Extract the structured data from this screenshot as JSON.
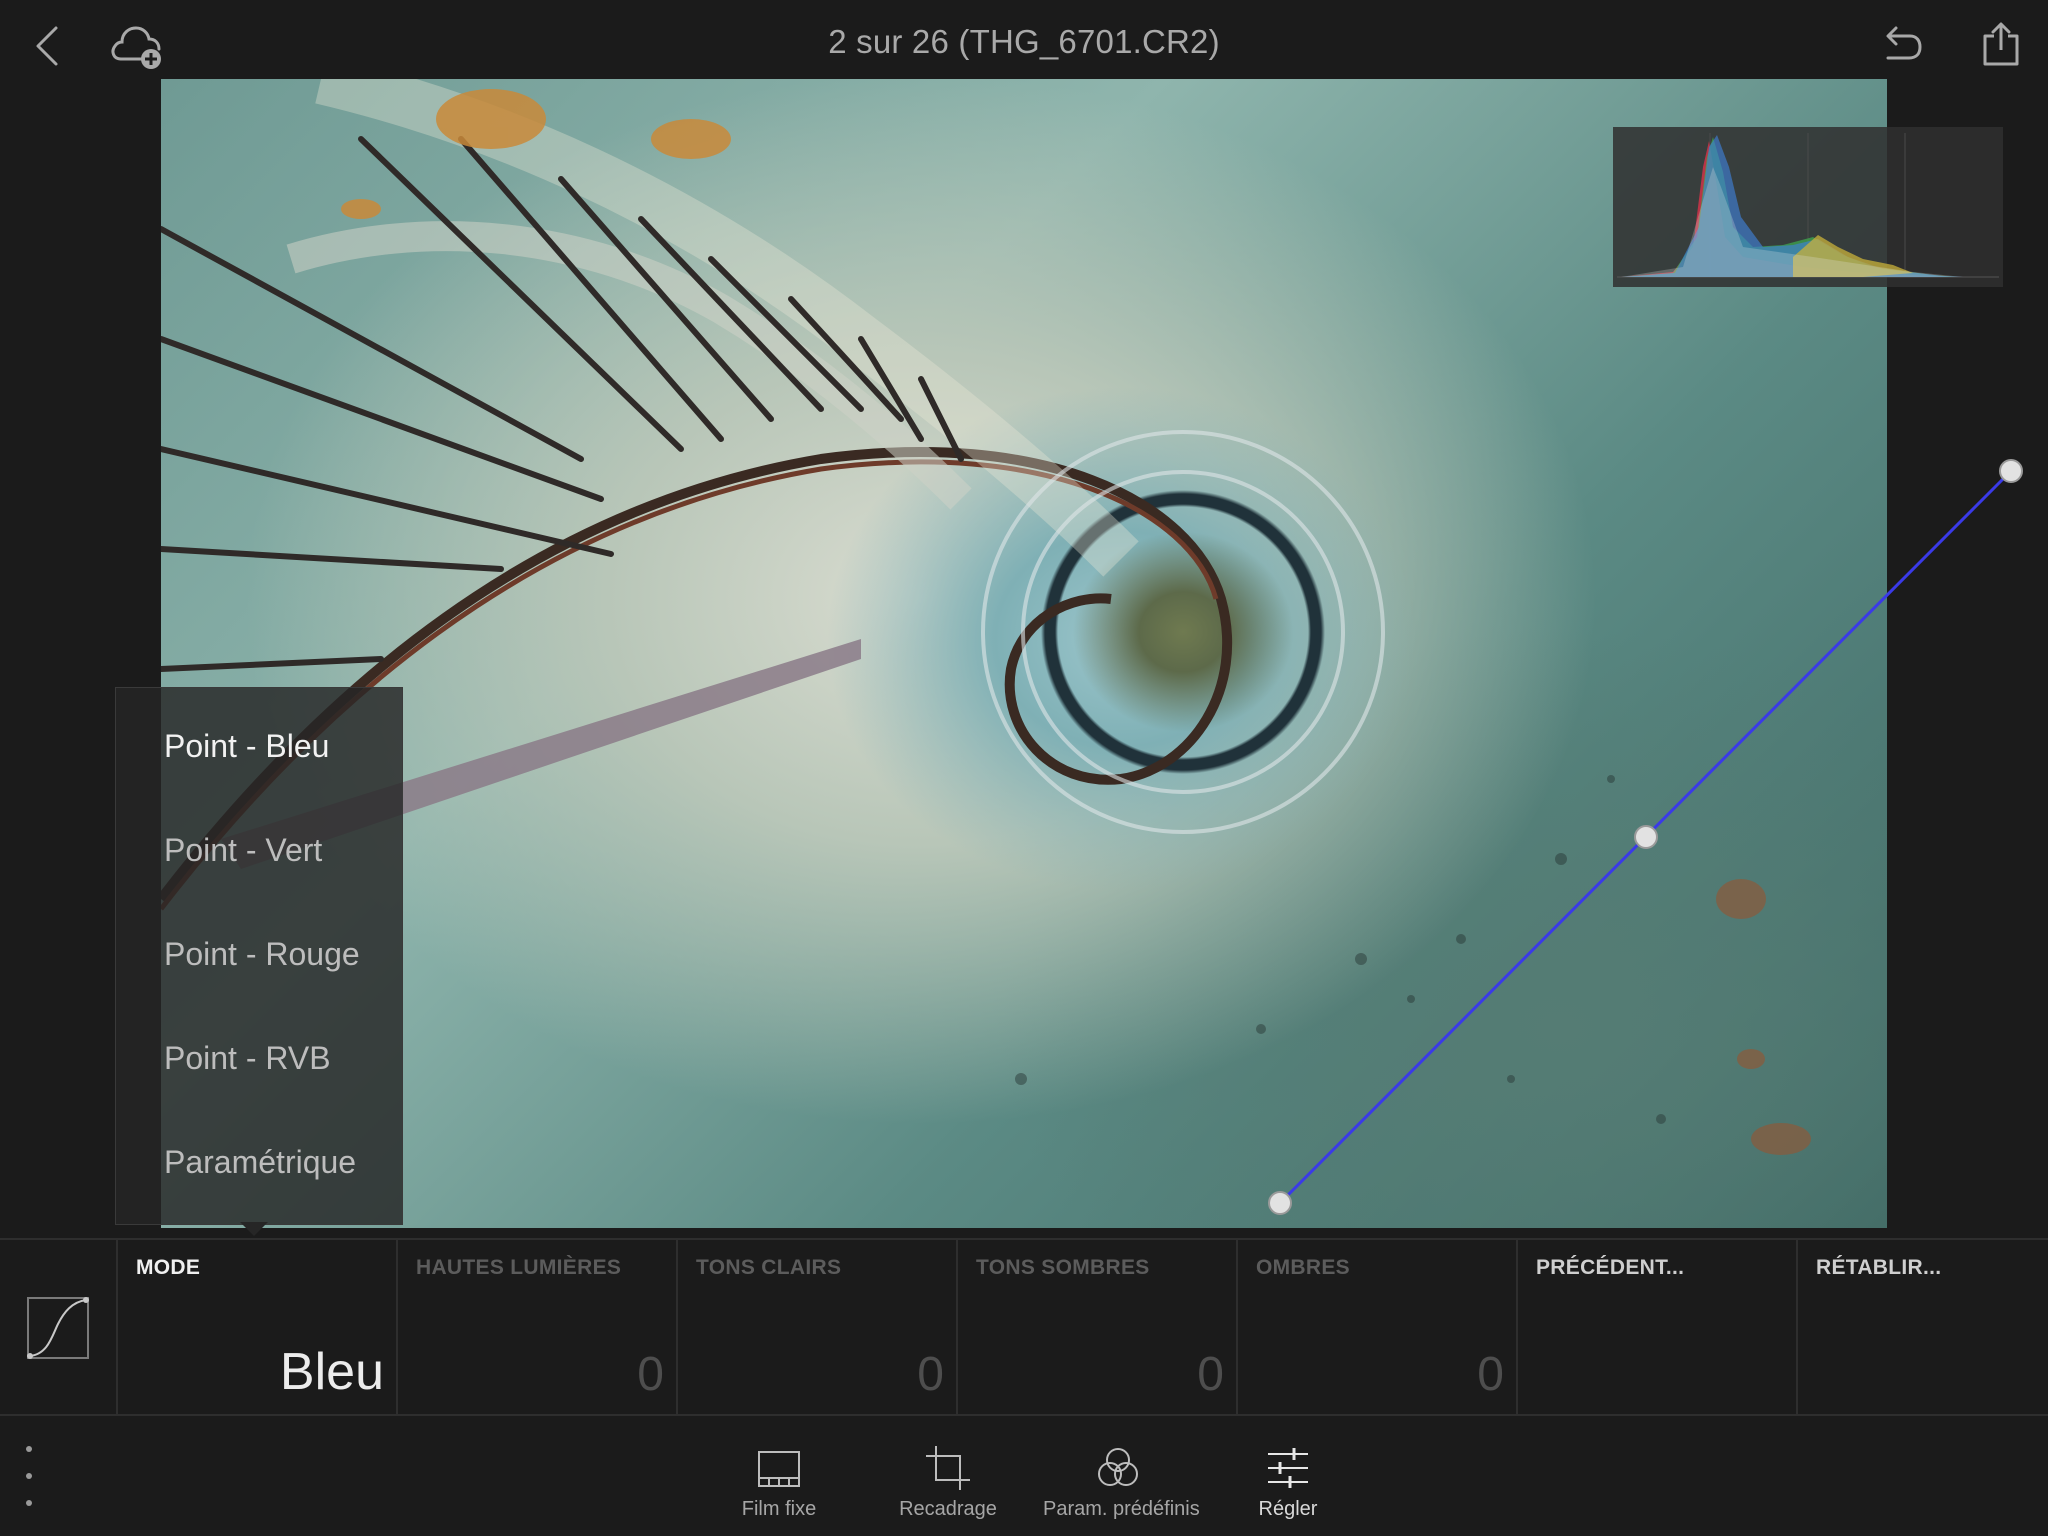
{
  "header": {
    "title": "2 sur 26 (THG_6701.CR2)",
    "icons": {
      "back": "chevron-left-icon",
      "cloud": "cloud-add-icon",
      "undo": "undo-icon",
      "share": "share-icon"
    }
  },
  "mode_menu": {
    "items": [
      {
        "label": "Point - Bleu",
        "active": true
      },
      {
        "label": "Point - Vert",
        "active": false
      },
      {
        "label": "Point - Rouge",
        "active": false
      },
      {
        "label": "Point - RVB",
        "active": false
      },
      {
        "label": "Paramétrique",
        "active": false
      }
    ]
  },
  "tone_curve": {
    "channel_color": "#3a3ae8",
    "points": [
      {
        "input": 0,
        "output": 0
      },
      {
        "input": 0.5,
        "output": 0.5
      },
      {
        "input": 1,
        "output": 1
      }
    ]
  },
  "panel": {
    "tool_icon": "tone-curve-icon",
    "cells": [
      {
        "label": "MODE",
        "value": "Bleu",
        "style": "active"
      },
      {
        "label": "HAUTES LUMIÈRES",
        "value": "0",
        "style": "dim"
      },
      {
        "label": "TONS CLAIRS",
        "value": "0",
        "style": "dim"
      },
      {
        "label": "TONS SOMBRES",
        "value": "0",
        "style": "dim"
      },
      {
        "label": "OMBRES",
        "value": "0",
        "style": "dim"
      },
      {
        "label": "PRÉCÉDENT...",
        "value": "",
        "style": "bright"
      },
      {
        "label": "RÉTABLIR...",
        "value": "",
        "style": "bright"
      }
    ]
  },
  "toolbar": {
    "more_icon": "more-vertical-icon",
    "tools": [
      {
        "label": "Film fixe",
        "icon": "filmstrip-icon"
      },
      {
        "label": "Recadrage",
        "icon": "crop-icon"
      },
      {
        "label": "Param. prédéfinis",
        "icon": "presets-icon"
      },
      {
        "label": "Régler",
        "icon": "sliders-icon"
      }
    ]
  },
  "colors": {
    "background": "#1b1b1b",
    "curve_blue": "#3a3ae8",
    "histogram_red": "#d8334a",
    "histogram_green": "#3fae4f",
    "histogram_blue": "#3f7fd6",
    "histogram_yellow": "#c9b23a"
  }
}
